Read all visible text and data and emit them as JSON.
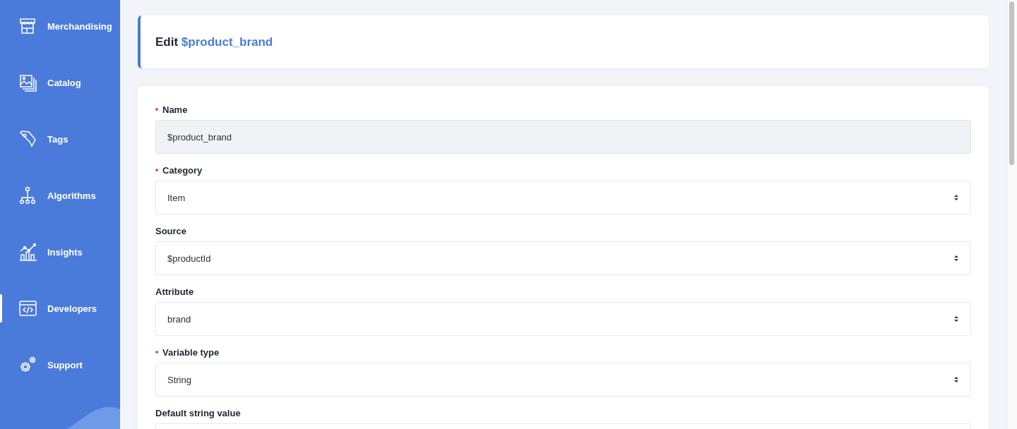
{
  "sidebar": {
    "items": [
      {
        "label": "Merchandising",
        "selected": false
      },
      {
        "label": "Catalog",
        "selected": false
      },
      {
        "label": "Tags",
        "selected": false
      },
      {
        "label": "Algorithms",
        "selected": false
      },
      {
        "label": "Insights",
        "selected": false
      },
      {
        "label": "Developers",
        "selected": true
      },
      {
        "label": "Support",
        "selected": false
      }
    ]
  },
  "header": {
    "prefix": "Edit",
    "name": "$product_brand"
  },
  "form": {
    "fields": [
      {
        "label": "Name",
        "required": true,
        "kind": "text",
        "value": "$product_brand",
        "disabled": true
      },
      {
        "label": "Category",
        "required": true,
        "kind": "select",
        "value": "Item"
      },
      {
        "label": "Source",
        "required": false,
        "kind": "select",
        "value": "$productId"
      },
      {
        "label": "Attribute",
        "required": false,
        "kind": "select",
        "value": "brand"
      },
      {
        "label": "Variable type",
        "required": true,
        "kind": "select",
        "value": "String"
      },
      {
        "label": "Default string value",
        "required": false,
        "kind": "text"
      }
    ]
  }
}
